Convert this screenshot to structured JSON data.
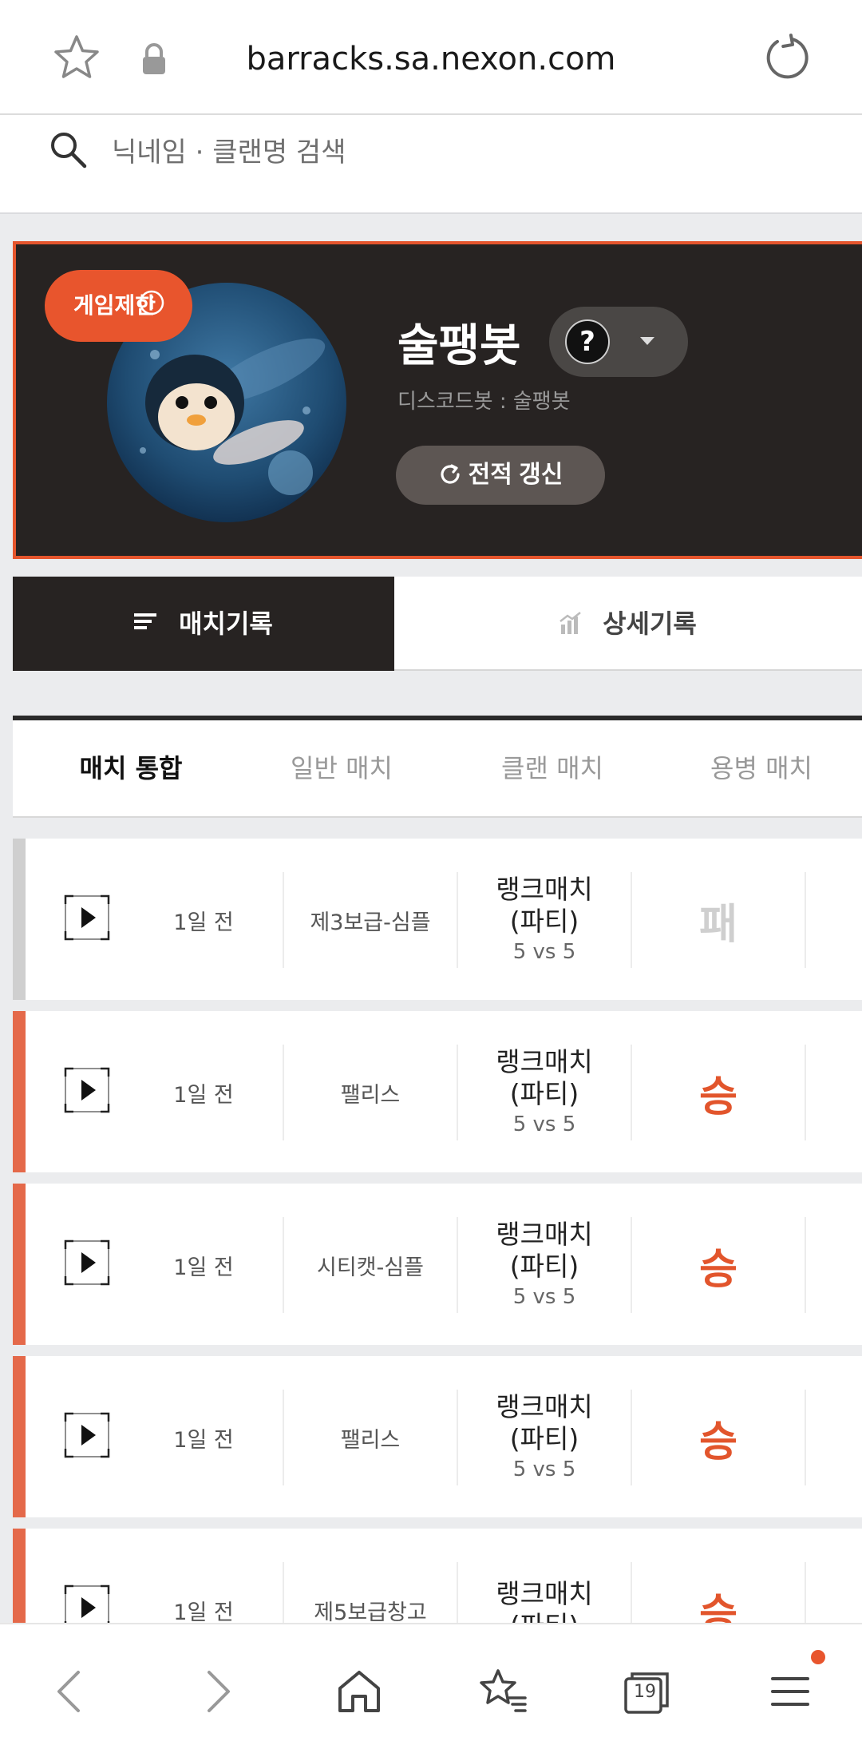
{
  "browser": {
    "url": "barracks.sa.nexon.com",
    "tab_count": "19"
  },
  "search": {
    "placeholder": "닉네임 · 클랜명 검색"
  },
  "profile": {
    "restriction_badge": "게임제한",
    "nickname": "술팽봇",
    "help_mark": "?",
    "meta": "디스코드봇 : 술팽봇",
    "refresh_label": "전적 갱신"
  },
  "main_tabs": {
    "match_record": "매치기록",
    "detail_record": "상세기록"
  },
  "sub_tabs": [
    "매치 통합",
    "일반 매치",
    "클랜 매치",
    "용병 매치"
  ],
  "matches": [
    {
      "time": "1일 전",
      "map": "제3보급-심플",
      "type_line1": "랭크매치",
      "type_line2": "(파티)",
      "mode": "5 vs 5",
      "result": "패"
    },
    {
      "time": "1일 전",
      "map": "팰리스",
      "type_line1": "랭크매치",
      "type_line2": "(파티)",
      "mode": "5 vs 5",
      "result": "승"
    },
    {
      "time": "1일 전",
      "map": "시티캣-심플",
      "type_line1": "랭크매치",
      "type_line2": "(파티)",
      "mode": "5 vs 5",
      "result": "승"
    },
    {
      "time": "1일 전",
      "map": "팰리스",
      "type_line1": "랭크매치",
      "type_line2": "(파티)",
      "mode": "5 vs 5",
      "result": "승"
    },
    {
      "time": "1일 전",
      "map": "제5보급창고",
      "type_line1": "랭크매치",
      "type_line2": "(파티)",
      "mode": "",
      "result": "승"
    }
  ],
  "colors": {
    "accent": "#e8552d",
    "dark": "#272322",
    "loss_bar": "#cfcfcf",
    "win_bar": "#e4694a"
  }
}
